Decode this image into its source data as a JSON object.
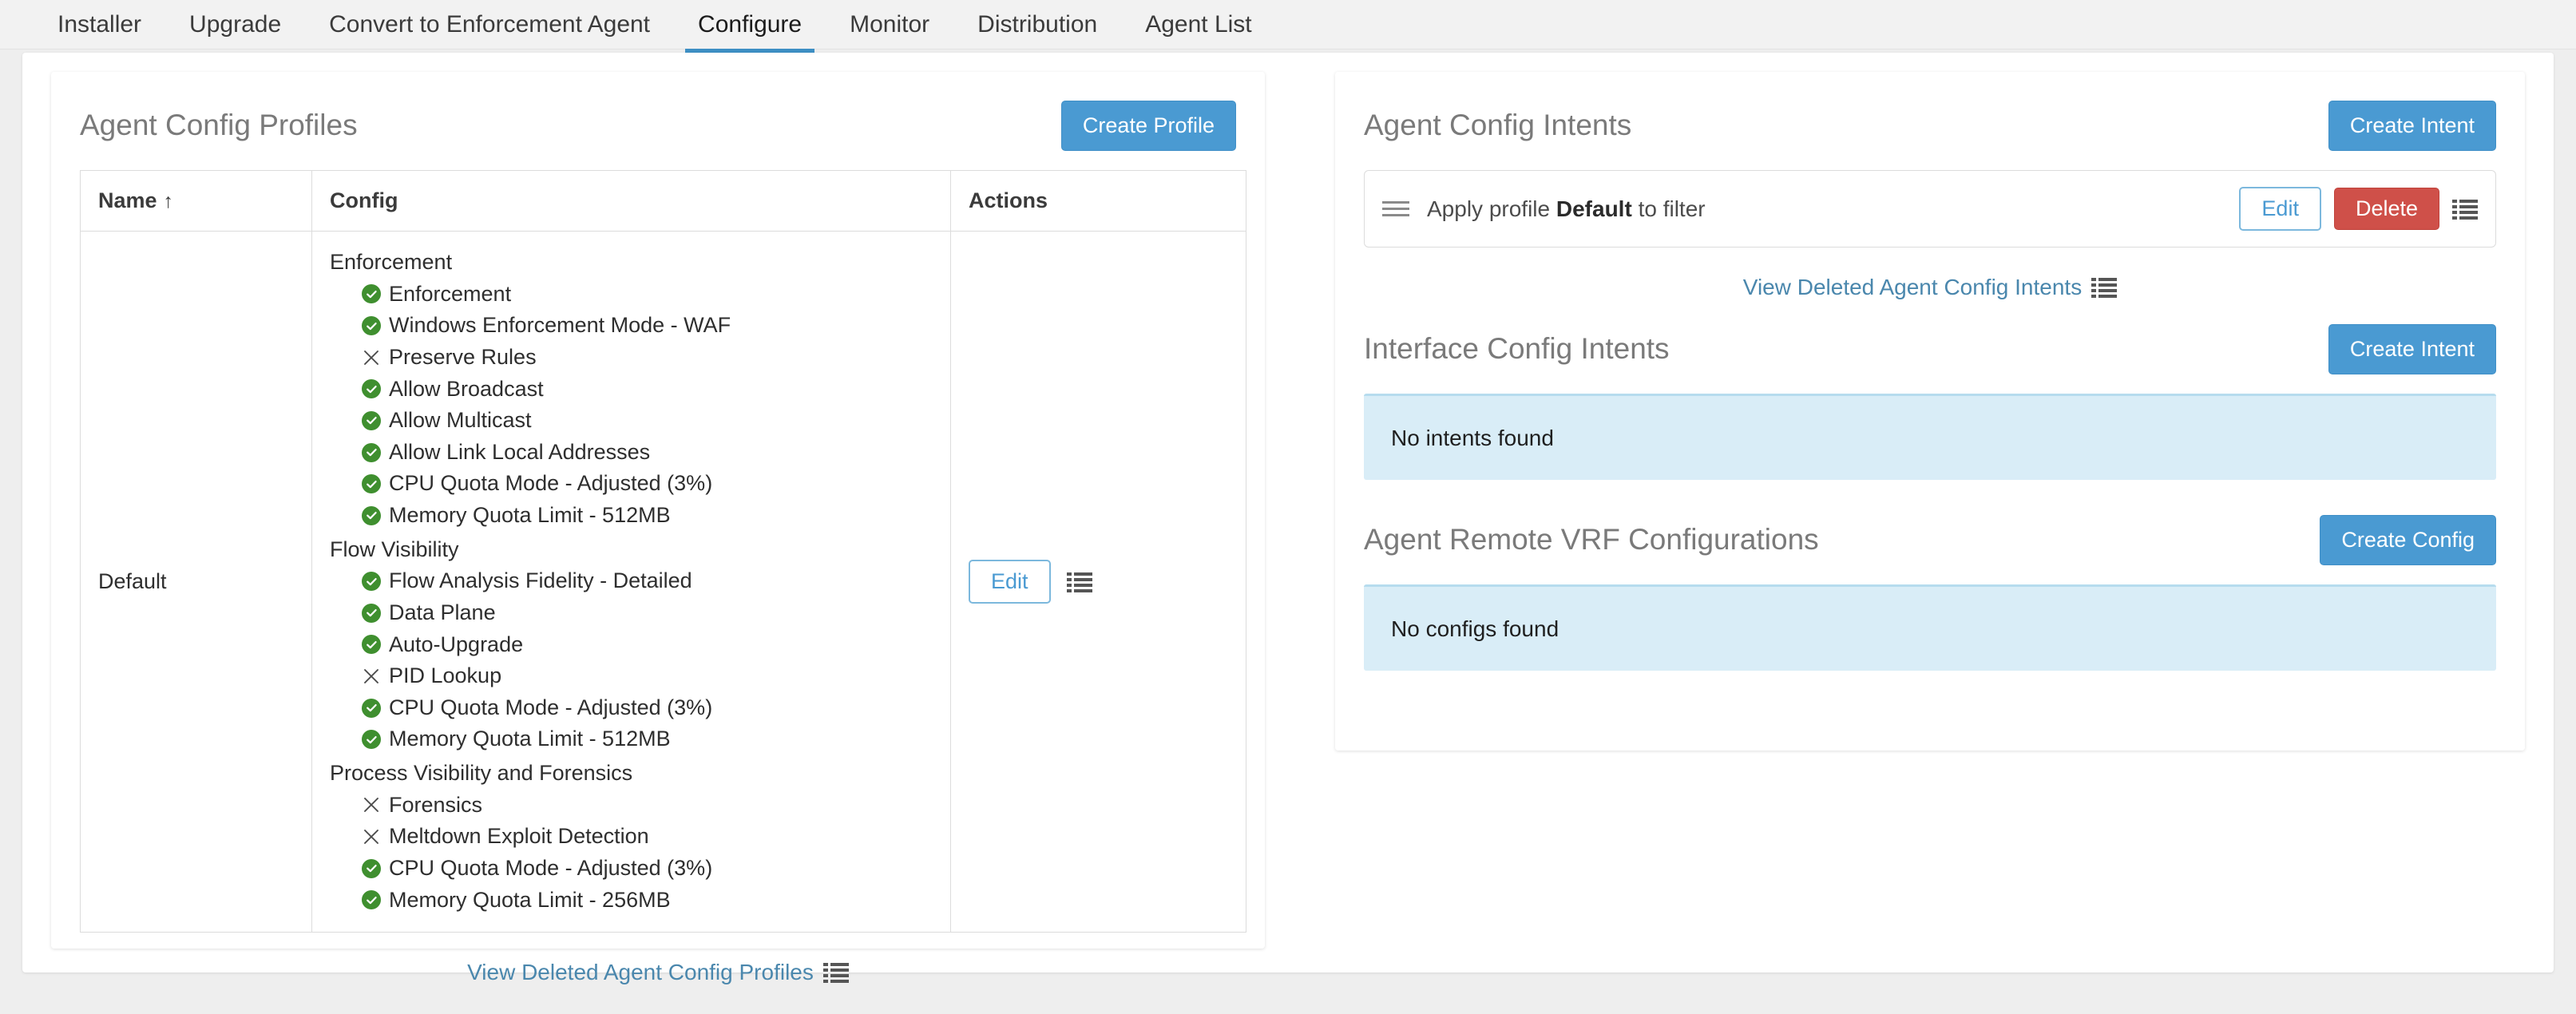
{
  "tabs": [
    {
      "label": "Installer",
      "active": false
    },
    {
      "label": "Upgrade",
      "active": false
    },
    {
      "label": "Convert to Enforcement Agent",
      "active": false
    },
    {
      "label": "Configure",
      "active": true
    },
    {
      "label": "Monitor",
      "active": false
    },
    {
      "label": "Distribution",
      "active": false
    },
    {
      "label": "Agent List",
      "active": false
    }
  ],
  "colors": {
    "accent_blue": "#4a9ad2",
    "danger_red": "#cf5049",
    "link_blue": "#4a87ad",
    "check_green": "#3f8f2f",
    "info_bg": "#d9edf7",
    "tab_underline": "#3d8fc4"
  },
  "left_panel": {
    "title": "Agent Config Profiles",
    "create_button": "Create Profile",
    "table": {
      "headers": {
        "name": "Name",
        "name_sort": "↑",
        "config": "Config",
        "actions": "Actions"
      },
      "row": {
        "name": "Default",
        "edit_label": "Edit",
        "groups": [
          {
            "title": "Enforcement",
            "items": [
              {
                "state": "check",
                "label": "Enforcement"
              },
              {
                "state": "check",
                "label": "Windows Enforcement Mode - WAF"
              },
              {
                "state": "cross",
                "label": "Preserve Rules"
              },
              {
                "state": "check",
                "label": "Allow Broadcast"
              },
              {
                "state": "check",
                "label": "Allow Multicast"
              },
              {
                "state": "check",
                "label": "Allow Link Local Addresses"
              },
              {
                "state": "check",
                "label": "CPU Quota Mode - Adjusted (3%)"
              },
              {
                "state": "check",
                "label": "Memory Quota Limit - 512MB"
              }
            ]
          },
          {
            "title": "Flow Visibility",
            "items": [
              {
                "state": "check",
                "label": "Flow Analysis Fidelity - Detailed"
              },
              {
                "state": "check",
                "label": "Data Plane"
              },
              {
                "state": "check",
                "label": "Auto-Upgrade"
              },
              {
                "state": "cross",
                "label": "PID Lookup"
              },
              {
                "state": "check",
                "label": "CPU Quota Mode - Adjusted (3%)"
              },
              {
                "state": "check",
                "label": "Memory Quota Limit - 512MB"
              }
            ]
          },
          {
            "title": "Process Visibility and Forensics",
            "items": [
              {
                "state": "cross",
                "label": "Forensics"
              },
              {
                "state": "cross",
                "label": "Meltdown Exploit Detection"
              },
              {
                "state": "check",
                "label": "CPU Quota Mode - Adjusted (3%)"
              },
              {
                "state": "check",
                "label": "Memory Quota Limit - 256MB"
              }
            ]
          }
        ]
      }
    },
    "view_deleted_link": "View Deleted Agent Config Profiles"
  },
  "right_panel": {
    "agent_config_intents": {
      "title": "Agent Config Intents",
      "create_button": "Create Intent",
      "intent": {
        "text_before": "Apply profile",
        "profile_name": "Default",
        "text_after": "to filter",
        "edit_label": "Edit",
        "delete_label": "Delete"
      },
      "view_deleted_link": "View Deleted Agent Config Intents"
    },
    "interface_config_intents": {
      "title": "Interface Config Intents",
      "create_button": "Create Intent",
      "empty_message": "No intents found"
    },
    "agent_remote_vrf": {
      "title": "Agent Remote VRF Configurations",
      "create_button": "Create Config",
      "empty_message": "No configs found"
    }
  }
}
